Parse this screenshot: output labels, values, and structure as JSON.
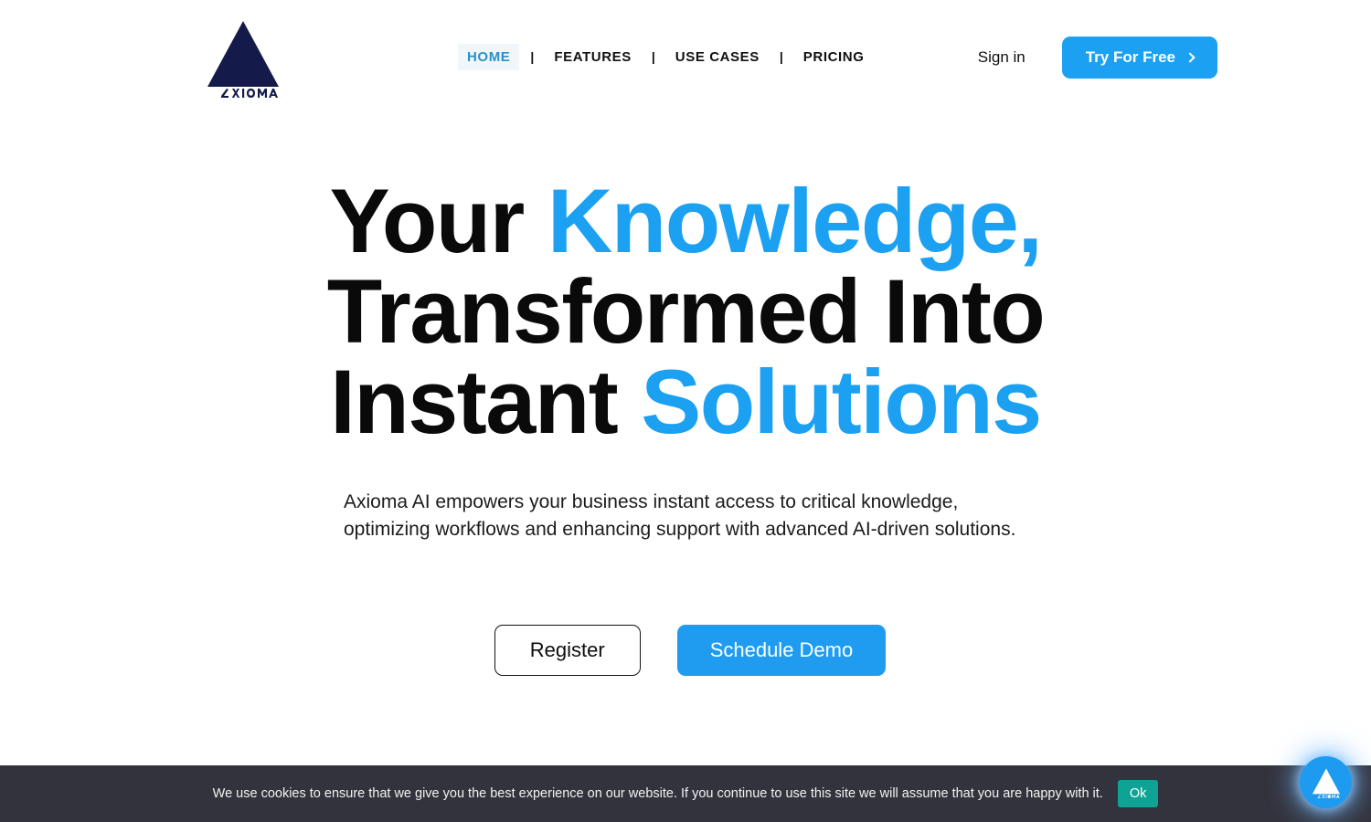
{
  "brand": {
    "name": "AXIOMA",
    "logo_icon": "axioma-triangle-logo",
    "logo_color": "#141a4a",
    "accent_color": "#1ba0f2"
  },
  "header": {
    "nav": [
      {
        "label": "HOME",
        "active": true
      },
      {
        "label": "FEATURES",
        "active": false
      },
      {
        "label": "USE CASES",
        "active": false
      },
      {
        "label": "PRICING",
        "active": false
      }
    ],
    "separator": "|",
    "signin_label": "Sign in",
    "try_label": "Try For Free",
    "try_icon": "chevron-right-icon"
  },
  "hero": {
    "title_part1": "Your ",
    "title_part2": "Knowledge,",
    "title_part3": "Transformed Into Instant ",
    "title_part4": "Solutions",
    "subtitle": "Axioma AI empowers your business instant access to critical knowledge, optimizing workflows and enhancing support with advanced AI-driven solutions.",
    "register_label": "Register",
    "demo_label": "Schedule Demo"
  },
  "cookie": {
    "message": "We use cookies to ensure that we give you the best experience on our website. If you continue to use this site we will assume that you are happy with it.",
    "ok_label": "Ok",
    "bar_color": "#33333d",
    "ok_color": "#0ea394"
  },
  "chat": {
    "icon": "axioma-logo-icon",
    "color": "#1d9bf0"
  }
}
